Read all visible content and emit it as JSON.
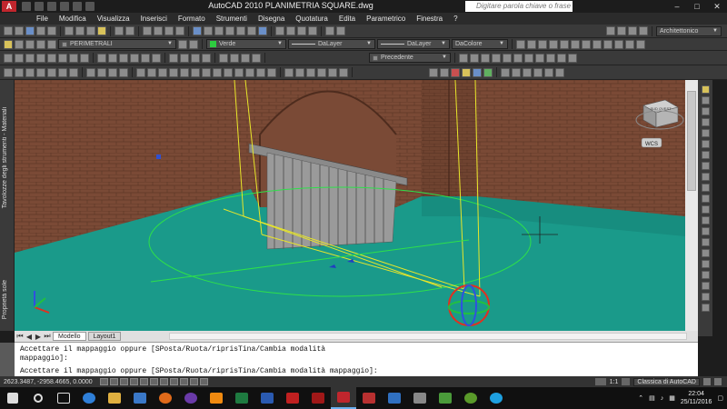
{
  "titlebar": {
    "app_logo": "A",
    "title": "AutoCAD 2010    PLANIMETRIA SQUARE.dwg",
    "search_placeholder": "Digitare parola chiave o frase",
    "minimize": "–",
    "maximize": "□",
    "close": "✕"
  },
  "menu": [
    "File",
    "Modifica",
    "Visualizza",
    "Inserisci",
    "Formato",
    "Strumenti",
    "Disegna",
    "Quotatura",
    "Edita",
    "Parametrico",
    "Finestra",
    "?"
  ],
  "toolbar1": {
    "style_combo": "Architettonico"
  },
  "toolbar2": {
    "layer_combo": "PERIMETRALI",
    "color_combo": "Verde",
    "linetype_combo": "DaLayer",
    "lineweight_combo": "DaLayer",
    "plotstyle_combo": "DaColore"
  },
  "toolbar3": {
    "view_combo": "Precedente"
  },
  "palettes": {
    "tools": "Tavolozze degli strumenti - Materiali",
    "properties": "Proprietà sole"
  },
  "viewport": {
    "wcs_label": "WCS",
    "viewcube_label": "SUD OVEST"
  },
  "tabs": {
    "model": "Modello",
    "layout": "Layout1"
  },
  "command_line": {
    "line1": "Accettare il mappaggio oppure [SPosta/Ruota/riprisTina/Cambia modalità",
    "line2": "mappaggio]:",
    "line3": "Accettare il mappaggio oppure [SPosta/Ruota/riprisTina/Cambia modalità mappaggio]:"
  },
  "statusbar": {
    "coords": "2623.3487, -2958.4665, 0.0000",
    "scale": "1:1",
    "workspace": "Classica di AutoCAD"
  },
  "taskbar": {
    "time": "22:04",
    "date": "25/11/2016"
  },
  "colors": {
    "wall": "#7a4a36",
    "floor": "#1a9a8a",
    "highlight": "#e8e62a"
  }
}
